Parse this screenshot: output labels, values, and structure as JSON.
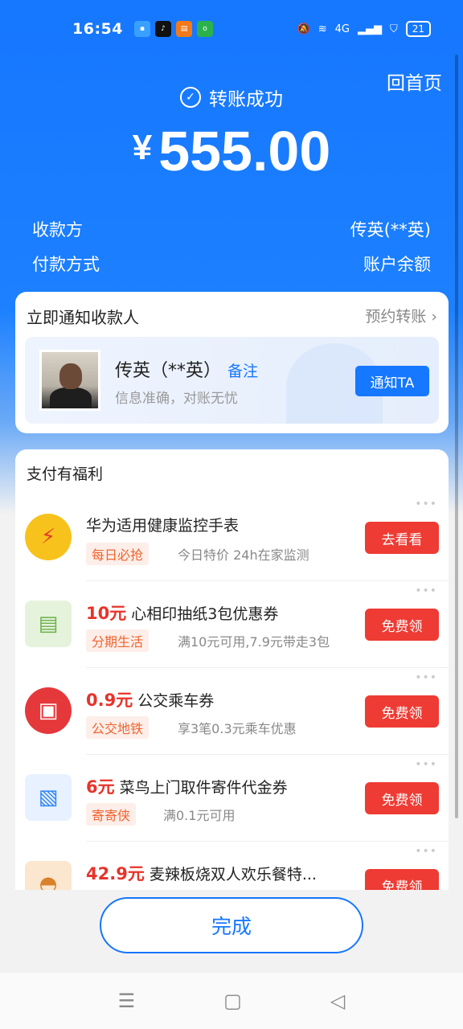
{
  "status_bar": {
    "time": "16:54",
    "network": "4G",
    "battery": "21"
  },
  "header": {
    "home_label": "回首页",
    "success_text": "转账成功",
    "currency_symbol": "¥",
    "amount": "555.00"
  },
  "details": {
    "payee_label": "收款方",
    "payee_value": "传英(**英)",
    "payment_method_label": "付款方式",
    "payment_method_value": "账户余额"
  },
  "notify": {
    "title": "立即通知收款人",
    "schedule_label": "预约转账",
    "payee_name": "传英（**英）",
    "note_label": "备注",
    "payee_sub": "信息准确，对账无忧",
    "notify_button": "通知TA"
  },
  "benefits": {
    "title": "支付有福利",
    "items": [
      {
        "price": "",
        "title": "华为适用健康监控手表",
        "tag": "每日必抢",
        "desc": "今日特价 24h在家监测",
        "button": "去看看",
        "icon": "watch-flash-icon",
        "icon_color": "#f7c21b"
      },
      {
        "price": "10元",
        "title": "心相印抽纸3包优惠券",
        "tag": "分期生活",
        "desc": "满10元可用,7.9元带走3包",
        "button": "免费领",
        "icon": "tissue-box-icon",
        "icon_color": "#9ccf7a"
      },
      {
        "price": "0.9元",
        "title": "公交乘车券",
        "tag": "公交地铁",
        "desc": "享3笔0.3元乘车优惠",
        "button": "免费领",
        "icon": "bus-icon",
        "icon_color": "#e5383b"
      },
      {
        "price": "6元",
        "title": "菜鸟上门取件寄件代金券",
        "tag": "寄寄侠",
        "desc": "满0.1元可用",
        "button": "免费领",
        "icon": "parcel-box-icon",
        "icon_color": "#2f86f5"
      },
      {
        "price": "42.9元",
        "title": "麦辣板烧双人欢乐餐特...",
        "tag": "",
        "desc": "",
        "button": "免费领",
        "icon": "burger-meal-icon",
        "icon_color": "#d9822b"
      }
    ]
  },
  "footer": {
    "done_button": "完成"
  },
  "nav": {
    "menu": "☰",
    "home": "▢",
    "back": "◁"
  }
}
